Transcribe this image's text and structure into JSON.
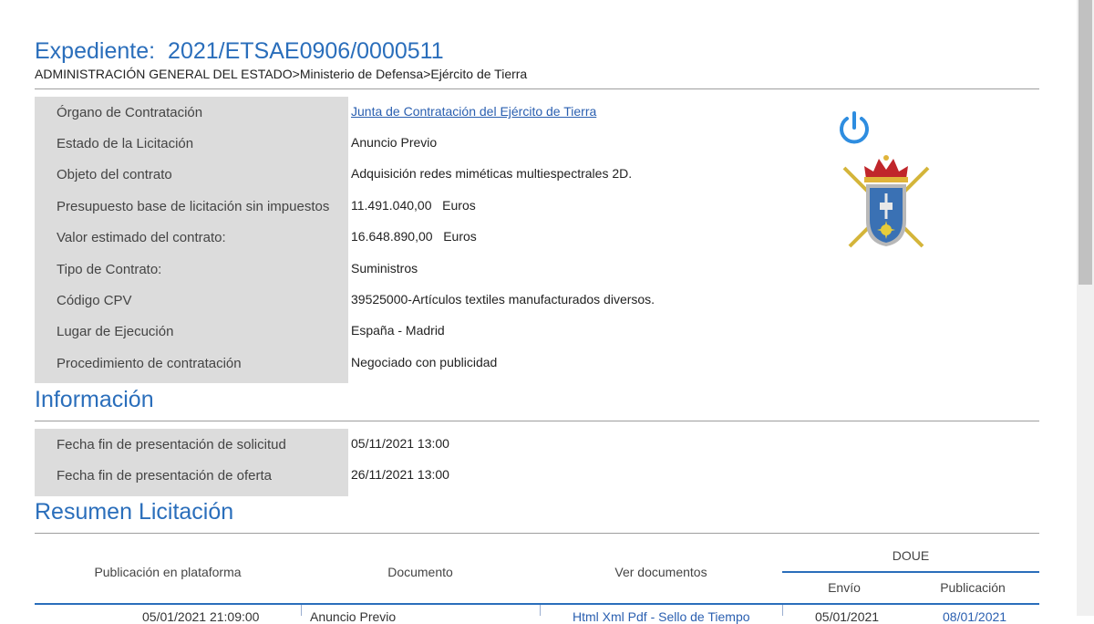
{
  "header": {
    "label": "Expediente:",
    "number": "2021/ETSAE0906/0000511",
    "breadcrumb": "ADMINISTRACIÓN GENERAL DEL ESTADO>Ministerio de Defensa>Ejército de Tierra"
  },
  "details": [
    {
      "label": "Órgano de Contratación",
      "value": "Junta de Contratación del Ejército de Tierra",
      "link": true
    },
    {
      "label": "Estado de la Licitación",
      "value": "Anuncio Previo"
    },
    {
      "label": "Objeto del contrato",
      "value": "Adquisición redes miméticas multiespectrales 2D."
    },
    {
      "label": "Presupuesto base de licitación sin impuestos",
      "value": "11.491.040,00   Euros"
    },
    {
      "label": "Valor estimado del contrato:",
      "value": "16.648.890,00   Euros"
    },
    {
      "label": "Tipo de Contrato:",
      "value": "Suministros"
    },
    {
      "label": "Código CPV",
      "value": "39525000-Artículos textiles manufacturados diversos."
    },
    {
      "label": "Lugar de Ejecución",
      "value": "España - Madrid"
    },
    {
      "label": "Procedimiento de contratación",
      "value": "Negociado con publicidad"
    }
  ],
  "informacion": {
    "title": "Información",
    "rows": [
      {
        "label": "Fecha fin de presentación de solicitud",
        "value": "05/11/2021 13:00"
      },
      {
        "label": "Fecha fin de presentación de oferta",
        "value": "26/11/2021 13:00"
      }
    ]
  },
  "resumen": {
    "title": "Resumen Licitación",
    "columns": {
      "publicacion_plataforma": "Publicación en plataforma",
      "documento": "Documento",
      "ver_documentos": "Ver documentos",
      "doue": "DOUE",
      "envio": "Envío",
      "publicacion": "Publicación"
    },
    "partial_row": {
      "fecha": "05/01/2021 21:09:00",
      "documento": "Anuncio Previo",
      "ver": "Html Xml Pdf - Sello de Tiempo",
      "envio": "05/01/2021",
      "publicacion": "08/01/2021"
    }
  },
  "icons": {
    "power": "power-icon",
    "crest": "coat-of-arms-emblem"
  },
  "colors": {
    "accent": "#2a6ebb",
    "label_bg": "#dcdcdc",
    "link": "#2a5fb0"
  }
}
